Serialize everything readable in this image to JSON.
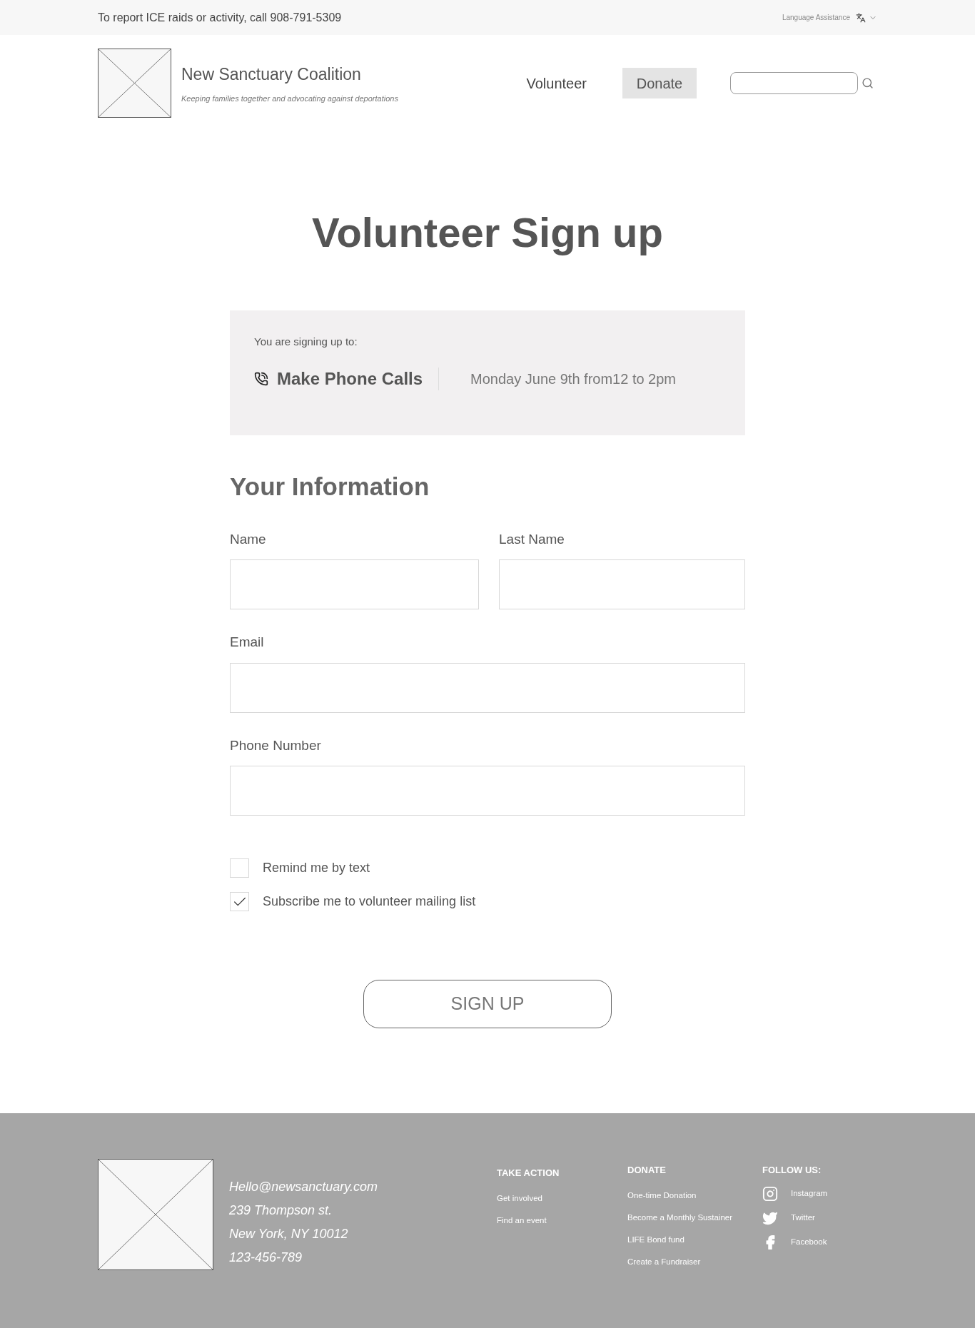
{
  "top_bar": {
    "notice": "To report ICE raids or activity, call 908-791-5309",
    "language": "Language Assistance"
  },
  "header": {
    "title": "New Sanctuary Coalition",
    "tagline": "Keeping families together and advocating against deportations",
    "nav": [
      {
        "label": "Volunteer",
        "kind": "link"
      },
      {
        "label": "Donate",
        "kind": "button"
      }
    ]
  },
  "page_title": "Volunteer Sign up",
  "summary": {
    "intro": "You are signing up to:",
    "activity": "Make Phone Calls",
    "time": "Monday June 9th from12 to 2pm"
  },
  "section_title": "Your Information",
  "fields": [
    {
      "label": "Name",
      "kind": "half"
    },
    {
      "label": "Last Name",
      "kind": "half"
    },
    {
      "label": "Email",
      "kind": "full"
    },
    {
      "label": "Phone Number",
      "kind": "full"
    }
  ],
  "options": [
    {
      "label": "Remind me by text",
      "checked": false
    },
    {
      "label": "Subscribe me to volunteer mailing list",
      "checked": true
    }
  ],
  "submit": "SIGN UP",
  "footer": {
    "contact": [
      "Hello@newsanctuary.com",
      "239 Thompson st.",
      "New York, NY 10012",
      "123-456-789"
    ],
    "columns": [
      {
        "title": "TAKE ACTION",
        "links": [
          "Get involved",
          "Find an event"
        ]
      },
      {
        "title": "DONATE",
        "links": [
          "One-time Donation",
          "Become a Monthly Sustainer",
          "LIFE Bond fund",
          "Create a Fundraiser"
        ]
      }
    ],
    "social": {
      "title": "FOLLOW US:",
      "items": [
        {
          "label": "Instagram",
          "kind": "instagram"
        },
        {
          "label": "Twitter",
          "kind": "twitter"
        },
        {
          "label": "Facebook",
          "kind": "facebook"
        }
      ]
    }
  }
}
